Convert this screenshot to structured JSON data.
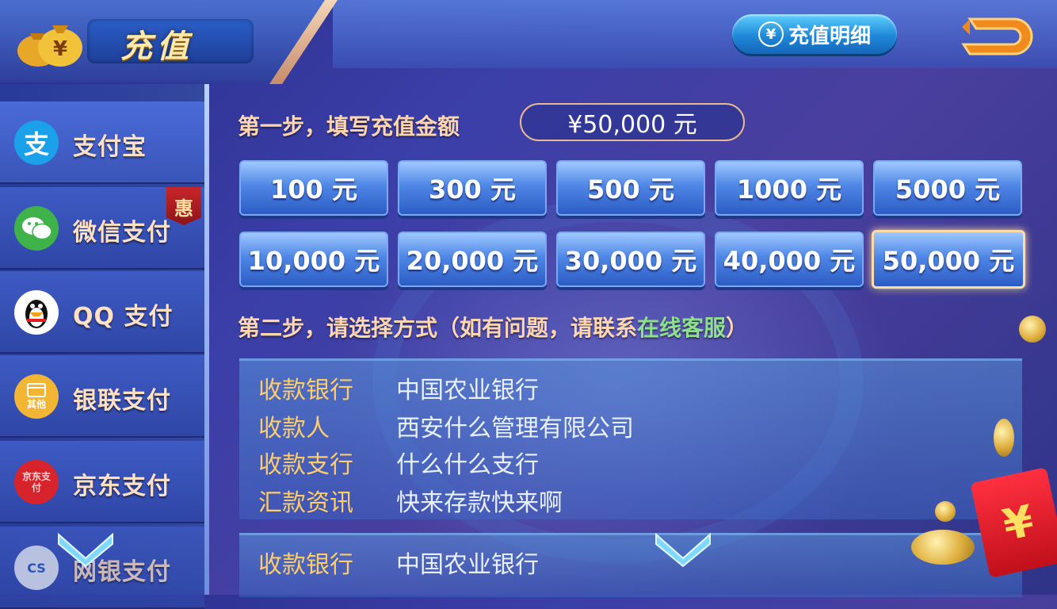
{
  "header": {
    "title": "充值",
    "history_button": "充值明细",
    "history_icon": "¥"
  },
  "sidebar": {
    "items": [
      {
        "label": "支付宝",
        "icon_text": "支",
        "color": "#1ba0ea"
      },
      {
        "label": "微信支付",
        "icon_text": "",
        "color": "#3fb24a",
        "badge": "惠"
      },
      {
        "label": "QQ 支付",
        "icon_text": "",
        "color": "#ffffff"
      },
      {
        "label": "银联支付",
        "icon_text": "其他",
        "color": "#f3b534"
      },
      {
        "label": "京东支付",
        "icon_text": "京东支付",
        "color": "#d6232c"
      },
      {
        "label": "网银支付",
        "icon_text": "CS",
        "color": "#e8eef8"
      }
    ]
  },
  "main": {
    "step1_label": "第一步，填写充值金额",
    "amount_value": "¥50,000 元",
    "amounts": [
      "100 元",
      "300 元",
      "500 元",
      "1000 元",
      "5000 元",
      "10,000 元",
      "20,000 元",
      "30,000 元",
      "40,000 元",
      "50,000 元"
    ],
    "selected_amount": "50,000 元",
    "step2_label": "第二步，请选择方式（如有问题，请联系",
    "step2_link": "在线客服",
    "step2_end": "）",
    "accounts": [
      {
        "rows": [
          {
            "key": "收款银行",
            "value": "中国农业银行"
          },
          {
            "key": "收款人",
            "value": "西安什么管理有限公司"
          },
          {
            "key": "收款支行",
            "value": "什么什么支行"
          },
          {
            "key": "汇款资讯",
            "value": "快来存款快来啊"
          }
        ]
      },
      {
        "rows": [
          {
            "key": "收款银行",
            "value": "中国农业银行"
          }
        ]
      }
    ]
  },
  "decor": {
    "red_packet_symbol": "¥"
  }
}
